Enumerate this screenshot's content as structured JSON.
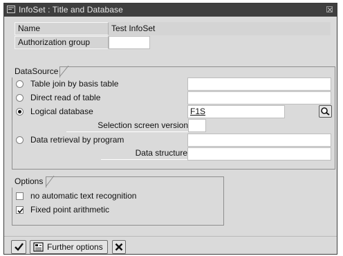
{
  "window": {
    "title": "InfoSet : Title and Database"
  },
  "header": {
    "name_label": "Name",
    "name_value": "Test InfoSet",
    "auth_label": "Authorization group",
    "auth_value": ""
  },
  "datasource": {
    "title": "DataSource",
    "options": [
      {
        "label": "Table join by basis table",
        "selected": false,
        "value": ""
      },
      {
        "label": "Direct read of table",
        "selected": false,
        "value": ""
      },
      {
        "label": "Logical database",
        "selected": true,
        "value": "F1S"
      }
    ],
    "selection_screen_label": "Selection screen version",
    "selection_screen_value": "",
    "retrieval_label": "Data retrieval by program",
    "retrieval_value": "",
    "data_structure_label": "Data structure",
    "data_structure_value": ""
  },
  "options": {
    "title": "Options",
    "items": [
      {
        "label": "no automatic text recognition",
        "checked": false
      },
      {
        "label": "Fixed point arithmetic",
        "checked": true
      }
    ]
  },
  "toolbar": {
    "further_options_label": "Further options"
  }
}
